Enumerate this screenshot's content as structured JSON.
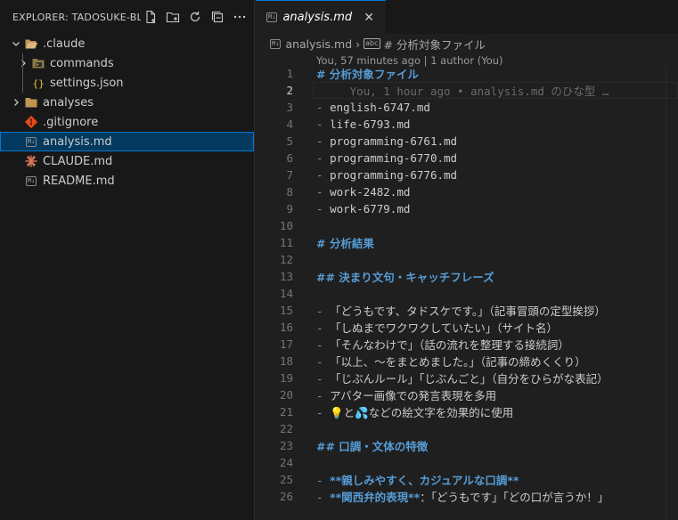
{
  "explorer": {
    "title": "EXPLORER: TADOSUKE-BL...",
    "actions": [
      "new-file",
      "new-folder",
      "refresh",
      "collapse-all",
      "more"
    ],
    "items": [
      {
        "label": ".claude",
        "kind": "folder-open",
        "depth": 0
      },
      {
        "label": "commands",
        "kind": "folder",
        "depth": 1
      },
      {
        "label": "settings.json",
        "kind": "json",
        "depth": 1
      },
      {
        "label": "analyses",
        "kind": "folder",
        "depth": 0
      },
      {
        "label": ".gitignore",
        "kind": "git",
        "depth": 0
      },
      {
        "label": "analysis.md",
        "kind": "md",
        "depth": 0,
        "selected": true
      },
      {
        "label": "CLAUDE.md",
        "kind": "claude",
        "depth": 0
      },
      {
        "label": "README.md",
        "kind": "md",
        "depth": 0
      }
    ]
  },
  "editor": {
    "tab": {
      "label": "analysis.md",
      "badge": "M↓",
      "close": "✕"
    },
    "breadcrumbs": {
      "file": "analysis.md",
      "symbol_icon": "abc",
      "symbol": "# 分析対象ファイル"
    },
    "blame_header": "You, 57 minutes ago | 1 author (You)",
    "inline_blame": "You, 1 hour ago • analysis.md のひな型 …",
    "lines": [
      {
        "n": "1",
        "text": "# 分析対象ファイル"
      },
      {
        "n": "2",
        "text": ""
      },
      {
        "n": "3",
        "text": "- english-6747.md"
      },
      {
        "n": "4",
        "text": "- life-6793.md"
      },
      {
        "n": "5",
        "text": "- programming-6761.md"
      },
      {
        "n": "6",
        "text": "- programming-6770.md"
      },
      {
        "n": "7",
        "text": "- programming-6776.md"
      },
      {
        "n": "8",
        "text": "- work-2482.md"
      },
      {
        "n": "9",
        "text": "- work-6779.md"
      },
      {
        "n": "10",
        "text": ""
      },
      {
        "n": "11",
        "text": "# 分析結果"
      },
      {
        "n": "12",
        "text": ""
      },
      {
        "n": "13",
        "text": "## 決まり文句・キャッチフレーズ"
      },
      {
        "n": "14",
        "text": ""
      },
      {
        "n": "15",
        "text": "「どうもです、タドスケです。」（記事冒頭の定型挨拶）"
      },
      {
        "n": "16",
        "text": "「しぬまでワクワクしていたい」（サイト名）"
      },
      {
        "n": "17",
        "text": "「そんなわけで」（話の流れを整理する接続詞）"
      },
      {
        "n": "18",
        "text": "「以上、〜をまとめました。」（記事の締めくくり）"
      },
      {
        "n": "19",
        "text": "「じぶんルール」「じぶんごと」（自分をひらがな表記）"
      },
      {
        "n": "20",
        "text": "アバター画像での発言表現を多用"
      },
      {
        "n": "21",
        "text": "などの絵文字を効果的に使用"
      },
      {
        "n": "22",
        "text": ""
      },
      {
        "n": "23",
        "text": "## 口調・文体の特徴"
      },
      {
        "n": "24",
        "text": ""
      },
      {
        "n": "25",
        "text": "**親しみやすく、カジュアルな口調**"
      },
      {
        "n": "26",
        "text": "**関西弁的表現**",
        "tail": "：「どうもです」「どの口が言うか！」"
      }
    ],
    "emoji_prefix": {
      "bulb": "💡",
      "and": "と",
      "drops": "💦"
    }
  }
}
